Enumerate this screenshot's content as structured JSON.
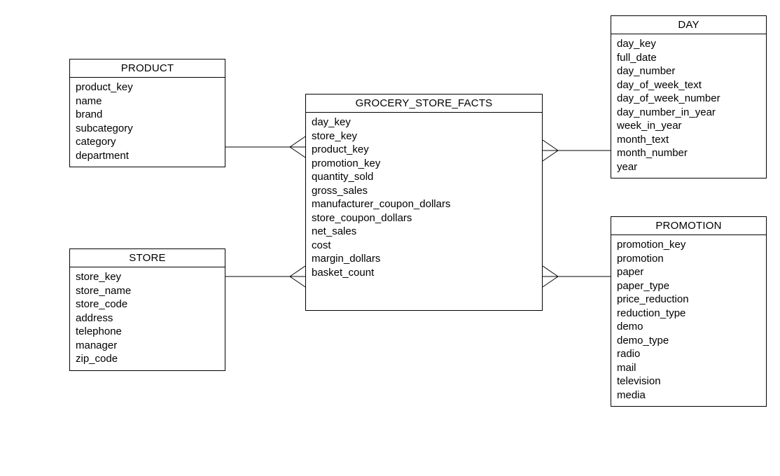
{
  "entities": {
    "product": {
      "title": "PRODUCT",
      "fields": [
        "product_key",
        "name",
        "brand",
        "subcategory",
        "category",
        "department"
      ]
    },
    "store": {
      "title": "STORE",
      "fields": [
        "store_key",
        "store_name",
        "store_code",
        "address",
        "telephone",
        "manager",
        "zip_code"
      ]
    },
    "facts": {
      "title": "GROCERY_STORE_FACTS",
      "fields": [
        "day_key",
        "store_key",
        "product_key",
        "promotion_key",
        "quantity_sold",
        "gross_sales",
        "manufacturer_coupon_dollars",
        "store_coupon_dollars",
        "net_sales",
        "cost",
        "margin_dollars",
        "basket_count"
      ]
    },
    "day": {
      "title": "DAY",
      "fields": [
        "day_key",
        "full_date",
        "day_number",
        "day_of_week_text",
        "day_of_week_number",
        "day_number_in_year",
        "week_in_year",
        "month_text",
        "month_number",
        "year"
      ]
    },
    "promotion": {
      "title": "PROMOTION",
      "fields": [
        "promotion_key",
        "promotion",
        "paper",
        "paper_type",
        "price_reduction",
        "reduction_type",
        "demo",
        "demo_type",
        "radio",
        "mail",
        "television",
        "media"
      ]
    }
  }
}
